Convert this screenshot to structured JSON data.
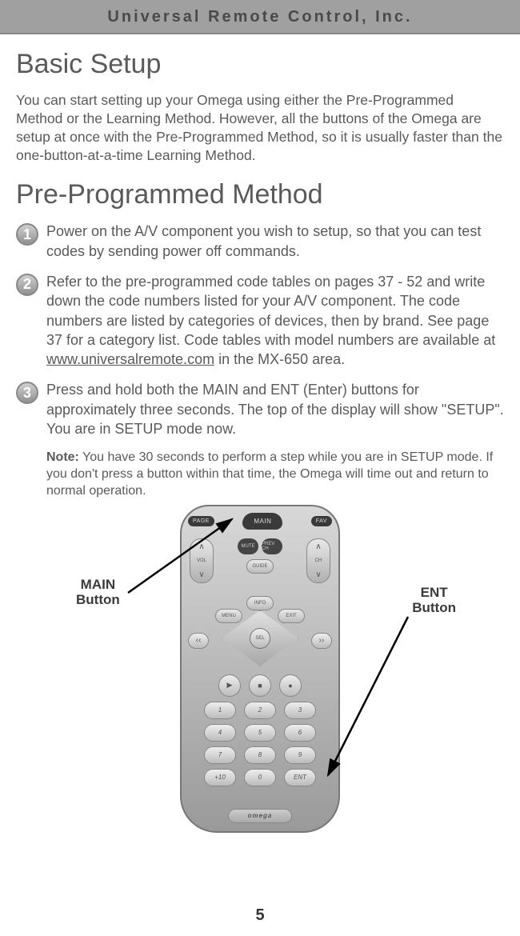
{
  "header": "Universal Remote Control, Inc.",
  "title1": "Basic Setup",
  "intro": "You can start setting up your Omega using either the Pre-Programmed Method or the Learning Method. However, all the buttons of the Omega are setup at once with the Pre-Programmed Method, so it is usually faster than the one-button-at-a-time Learning Method.",
  "title2": "Pre-Programmed Method",
  "steps": {
    "s1": {
      "num": "1",
      "text": "Power on the A/V component you wish to setup, so that you can test codes by sending power off commands."
    },
    "s2": {
      "num": "2",
      "textA": "Refer to the pre-programmed code tables on pages 37 - 52 and write down the code numbers listed for your A/V component. The code numbers are listed by categories of devices, then by brand. See page 37 for a category list. Code tables with model numbers are available at ",
      "link": "www.universalremote.com",
      "textB": " in the MX-650 area."
    },
    "s3": {
      "num": "3",
      "text": "Press and hold both the MAIN and ENT (Enter) buttons for approximately three seconds. The top of the display will show \"SETUP\". You are in SETUP mode now."
    }
  },
  "noteLabel": "Note:",
  "noteText": " You have 30 seconds to perform a step while you are in SETUP mode. If you don't press a button within that time, the Omega will time out and return to normal operation.",
  "callouts": {
    "main": "MAIN\nButton",
    "ent": "ENT\nButton"
  },
  "remote": {
    "page": "PAGE",
    "main": "MAIN",
    "fav": "FAV",
    "mute": "MUTE",
    "prev": "PREV CH",
    "vol": "VOL",
    "ch": "CH",
    "guide": "GUIDE",
    "menu": "MENU",
    "info": "INFO",
    "exit": "EXIT",
    "sel": "SEL",
    "keys": [
      "1",
      "2",
      "3",
      "4",
      "5",
      "6",
      "7",
      "8",
      "9",
      "+10",
      "0",
      "ENT"
    ],
    "brand": "omega"
  },
  "pageNumber": "5"
}
